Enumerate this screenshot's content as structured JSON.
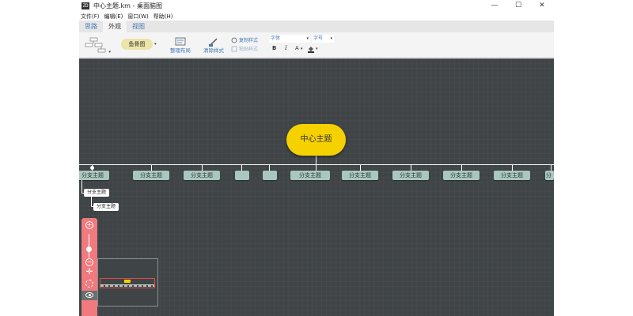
{
  "window": {
    "title": "中心主题.km - 桌面脑图",
    "icon_text": "ZD",
    "controls": {
      "minimize": "—",
      "maximize": "☐",
      "close": "✕"
    }
  },
  "menu": [
    "文件(F)",
    "编辑(E)",
    "窗口(W)",
    "帮助(H)"
  ],
  "tabs": [
    {
      "label": "思路",
      "active": false
    },
    {
      "label": "外观",
      "active": true
    },
    {
      "label": "视图",
      "active": false
    }
  ],
  "ribbon": {
    "theme_label": "鱼骨图",
    "arrange_label": "整理布局",
    "clear_style_label": "清除样式",
    "copy_style_label": "复制样式",
    "paste_style_label": "粘贴样式",
    "font_placeholder": "字体",
    "font_size_placeholder": "字号",
    "bold": "B",
    "italic": "I",
    "font_color": "A",
    "dropdown_arrow": "▾",
    "colors": {
      "accent": "#4478b8",
      "theme_button": "#ece4a8"
    }
  },
  "canvas": {
    "background": "#3f4447",
    "center_topic": "中心主题",
    "center_color": "#f5d100",
    "branch_color": "#a8c8bd",
    "branches": [
      "分支主题",
      "分支主题",
      "分支主题",
      "",
      "",
      "分支主题",
      "分支主题",
      "分支主题",
      "分支主题",
      "分支主题",
      "分"
    ],
    "sub_topics": [
      "分支主题",
      "分支主题"
    ]
  },
  "zoom_panel": {
    "zoom_in": "+",
    "zoom_out": "−",
    "move": "✛",
    "color": "#f07a7e"
  }
}
